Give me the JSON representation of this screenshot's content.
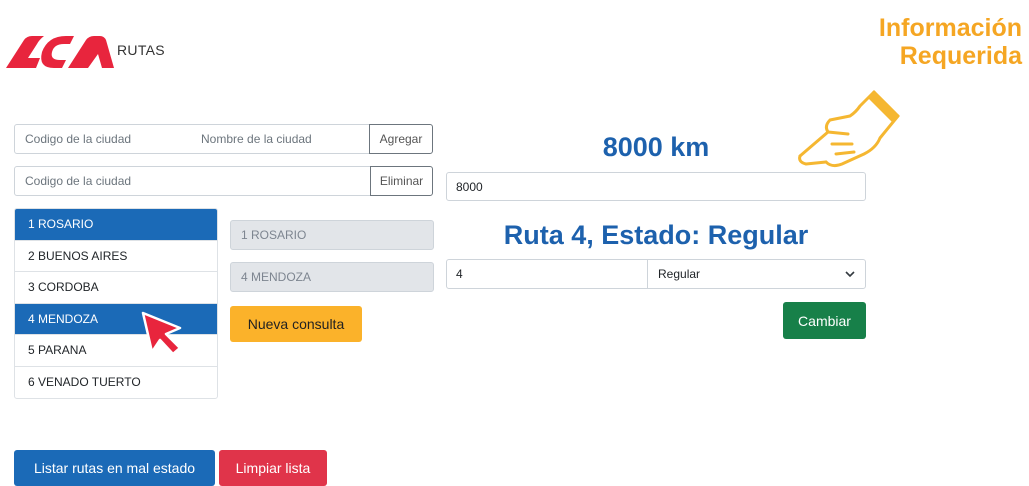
{
  "header": {
    "brand": "RUTAS",
    "logo_icon": "aca-logo-icon",
    "logo_color": "#e8253d"
  },
  "note": {
    "line1": "Información",
    "line2": "Requerida",
    "color": "#f5a623",
    "icon": "pointing-hand-icon"
  },
  "add_form": {
    "code_placeholder": "Codigo de la ciudad",
    "name_placeholder": "Nombre de la ciudad",
    "add_label": "Agregar"
  },
  "delete_form": {
    "code_placeholder": "Codigo de la ciudad",
    "delete_label": "Eliminar"
  },
  "cities": [
    {
      "label": "1 ROSARIO",
      "active": true
    },
    {
      "label": "2 BUENOS AIRES",
      "active": false
    },
    {
      "label": "3 CORDOBA",
      "active": false
    },
    {
      "label": "4 MENDOZA",
      "active": true
    },
    {
      "label": "5 PARANA",
      "active": false
    },
    {
      "label": "6 VENADO TUERTO",
      "active": false
    }
  ],
  "selection": {
    "origin": "1 ROSARIO",
    "destination": "4 MENDOZA",
    "new_query_label": "Nueva consulta"
  },
  "result": {
    "distance_heading": "8000 km",
    "distance_value": "8000",
    "route_heading": "Ruta 4, Estado: Regular",
    "route_number": "4",
    "route_state": "Regular",
    "change_label": "Cambiar"
  },
  "footer": {
    "list_bad_label": "Listar rutas en mal estado",
    "clear_label": "Limpiar lista"
  },
  "colors": {
    "primary": "#1b6ab7",
    "success": "#178049",
    "warning": "#fbb22a",
    "danger": "#e0344a"
  },
  "cursor_icon": "red-arrow-cursor-icon"
}
